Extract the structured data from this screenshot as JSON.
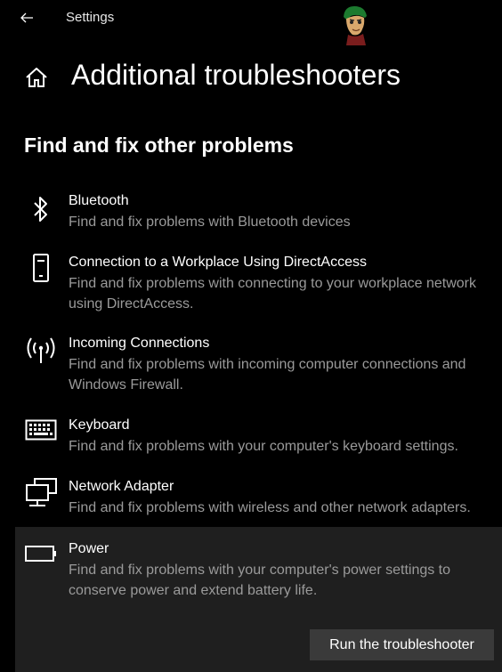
{
  "window": {
    "title": "Settings"
  },
  "header": {
    "title": "Additional troubleshooters"
  },
  "section": {
    "title": "Find and fix other problems"
  },
  "items": [
    {
      "name": "Bluetooth",
      "description": "Find and fix problems with Bluetooth devices",
      "icon": "bluetooth-icon"
    },
    {
      "name": "Connection to a Workplace Using DirectAccess",
      "description": "Find and fix problems with connecting to your workplace network using DirectAccess.",
      "icon": "phone-device-icon"
    },
    {
      "name": "Incoming Connections",
      "description": "Find and fix problems with incoming computer connections and Windows Firewall.",
      "icon": "antenna-signal-icon"
    },
    {
      "name": "Keyboard",
      "description": "Find and fix problems with your computer's keyboard settings.",
      "icon": "keyboard-icon"
    },
    {
      "name": "Network Adapter",
      "description": "Find and fix problems with wireless and other network adapters.",
      "icon": "network-adapter-icon"
    },
    {
      "name": "Power",
      "description": "Find and fix problems with your computer's power settings to conserve power and extend battery life.",
      "icon": "battery-icon"
    }
  ],
  "run_button": {
    "label": "Run the troubleshooter"
  },
  "colors": {
    "background": "#000000",
    "selected_background": "#1f1f1f",
    "button_background": "#3a3a3a",
    "secondary_text": "#9a9a9a"
  }
}
